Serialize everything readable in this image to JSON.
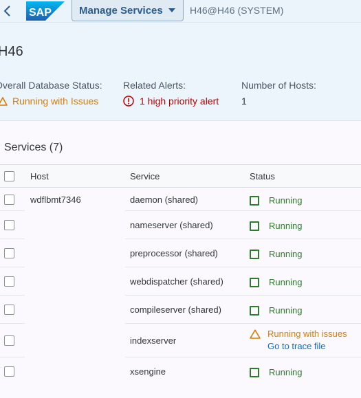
{
  "shell": {
    "logo_text": "SAP",
    "app_title": "Manage Services",
    "system": "H46@H46 (SYSTEM)"
  },
  "header": {
    "title": "H46",
    "kpis": [
      {
        "label": "Overall Database Status:",
        "value": "Running with Issues"
      },
      {
        "label": "Related Alerts:",
        "value": "1 high priority alert"
      },
      {
        "label": "Number of Hosts:",
        "value": "1"
      }
    ]
  },
  "services": {
    "title": "Services (7)",
    "columns": [
      "Host",
      "Service",
      "Status"
    ],
    "rows": [
      {
        "host": "wdflbmt7346",
        "service": "daemon (shared)",
        "status": "Running"
      },
      {
        "host": "",
        "service": "nameserver (shared)",
        "status": "Running"
      },
      {
        "host": "",
        "service": "preprocessor (shared)",
        "status": "Running"
      },
      {
        "host": "",
        "service": "webdispatcher (shared)",
        "status": "Running"
      },
      {
        "host": "",
        "service": "compileserver (shared)",
        "status": "Running"
      },
      {
        "host": "",
        "service": "indexserver",
        "status": "Running with issues",
        "link": "Go to trace file"
      },
      {
        "host": "",
        "service": "xsengine",
        "status": "Running"
      }
    ]
  },
  "colors": {
    "brand": "#0a6ed1",
    "running": "#2b7c2b",
    "warning": "#d97d00",
    "error": "#bb0000"
  }
}
